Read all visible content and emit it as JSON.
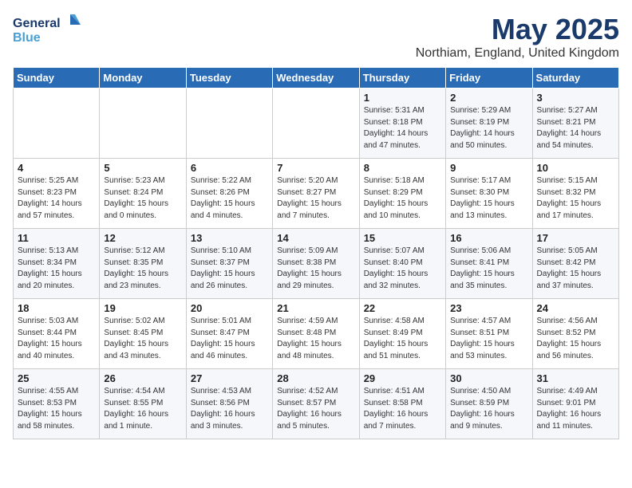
{
  "logo": {
    "line1": "General",
    "line2": "Blue"
  },
  "title": "May 2025",
  "subtitle": "Northiam, England, United Kingdom",
  "days_of_week": [
    "Sunday",
    "Monday",
    "Tuesday",
    "Wednesday",
    "Thursday",
    "Friday",
    "Saturday"
  ],
  "weeks": [
    [
      {
        "day": "",
        "info": ""
      },
      {
        "day": "",
        "info": ""
      },
      {
        "day": "",
        "info": ""
      },
      {
        "day": "",
        "info": ""
      },
      {
        "day": "1",
        "info": "Sunrise: 5:31 AM\nSunset: 8:18 PM\nDaylight: 14 hours\nand 47 minutes."
      },
      {
        "day": "2",
        "info": "Sunrise: 5:29 AM\nSunset: 8:19 PM\nDaylight: 14 hours\nand 50 minutes."
      },
      {
        "day": "3",
        "info": "Sunrise: 5:27 AM\nSunset: 8:21 PM\nDaylight: 14 hours\nand 54 minutes."
      }
    ],
    [
      {
        "day": "4",
        "info": "Sunrise: 5:25 AM\nSunset: 8:23 PM\nDaylight: 14 hours\nand 57 minutes."
      },
      {
        "day": "5",
        "info": "Sunrise: 5:23 AM\nSunset: 8:24 PM\nDaylight: 15 hours\nand 0 minutes."
      },
      {
        "day": "6",
        "info": "Sunrise: 5:22 AM\nSunset: 8:26 PM\nDaylight: 15 hours\nand 4 minutes."
      },
      {
        "day": "7",
        "info": "Sunrise: 5:20 AM\nSunset: 8:27 PM\nDaylight: 15 hours\nand 7 minutes."
      },
      {
        "day": "8",
        "info": "Sunrise: 5:18 AM\nSunset: 8:29 PM\nDaylight: 15 hours\nand 10 minutes."
      },
      {
        "day": "9",
        "info": "Sunrise: 5:17 AM\nSunset: 8:30 PM\nDaylight: 15 hours\nand 13 minutes."
      },
      {
        "day": "10",
        "info": "Sunrise: 5:15 AM\nSunset: 8:32 PM\nDaylight: 15 hours\nand 17 minutes."
      }
    ],
    [
      {
        "day": "11",
        "info": "Sunrise: 5:13 AM\nSunset: 8:34 PM\nDaylight: 15 hours\nand 20 minutes."
      },
      {
        "day": "12",
        "info": "Sunrise: 5:12 AM\nSunset: 8:35 PM\nDaylight: 15 hours\nand 23 minutes."
      },
      {
        "day": "13",
        "info": "Sunrise: 5:10 AM\nSunset: 8:37 PM\nDaylight: 15 hours\nand 26 minutes."
      },
      {
        "day": "14",
        "info": "Sunrise: 5:09 AM\nSunset: 8:38 PM\nDaylight: 15 hours\nand 29 minutes."
      },
      {
        "day": "15",
        "info": "Sunrise: 5:07 AM\nSunset: 8:40 PM\nDaylight: 15 hours\nand 32 minutes."
      },
      {
        "day": "16",
        "info": "Sunrise: 5:06 AM\nSunset: 8:41 PM\nDaylight: 15 hours\nand 35 minutes."
      },
      {
        "day": "17",
        "info": "Sunrise: 5:05 AM\nSunset: 8:42 PM\nDaylight: 15 hours\nand 37 minutes."
      }
    ],
    [
      {
        "day": "18",
        "info": "Sunrise: 5:03 AM\nSunset: 8:44 PM\nDaylight: 15 hours\nand 40 minutes."
      },
      {
        "day": "19",
        "info": "Sunrise: 5:02 AM\nSunset: 8:45 PM\nDaylight: 15 hours\nand 43 minutes."
      },
      {
        "day": "20",
        "info": "Sunrise: 5:01 AM\nSunset: 8:47 PM\nDaylight: 15 hours\nand 46 minutes."
      },
      {
        "day": "21",
        "info": "Sunrise: 4:59 AM\nSunset: 8:48 PM\nDaylight: 15 hours\nand 48 minutes."
      },
      {
        "day": "22",
        "info": "Sunrise: 4:58 AM\nSunset: 8:49 PM\nDaylight: 15 hours\nand 51 minutes."
      },
      {
        "day": "23",
        "info": "Sunrise: 4:57 AM\nSunset: 8:51 PM\nDaylight: 15 hours\nand 53 minutes."
      },
      {
        "day": "24",
        "info": "Sunrise: 4:56 AM\nSunset: 8:52 PM\nDaylight: 15 hours\nand 56 minutes."
      }
    ],
    [
      {
        "day": "25",
        "info": "Sunrise: 4:55 AM\nSunset: 8:53 PM\nDaylight: 15 hours\nand 58 minutes."
      },
      {
        "day": "26",
        "info": "Sunrise: 4:54 AM\nSunset: 8:55 PM\nDaylight: 16 hours\nand 1 minute."
      },
      {
        "day": "27",
        "info": "Sunrise: 4:53 AM\nSunset: 8:56 PM\nDaylight: 16 hours\nand 3 minutes."
      },
      {
        "day": "28",
        "info": "Sunrise: 4:52 AM\nSunset: 8:57 PM\nDaylight: 16 hours\nand 5 minutes."
      },
      {
        "day": "29",
        "info": "Sunrise: 4:51 AM\nSunset: 8:58 PM\nDaylight: 16 hours\nand 7 minutes."
      },
      {
        "day": "30",
        "info": "Sunrise: 4:50 AM\nSunset: 8:59 PM\nDaylight: 16 hours\nand 9 minutes."
      },
      {
        "day": "31",
        "info": "Sunrise: 4:49 AM\nSunset: 9:01 PM\nDaylight: 16 hours\nand 11 minutes."
      }
    ]
  ]
}
